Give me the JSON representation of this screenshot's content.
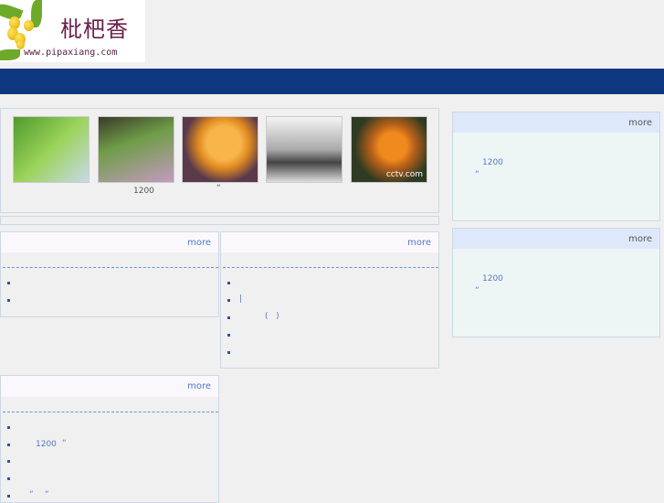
{
  "logo": {
    "title": "枇杷香",
    "url": "www.pipaxiang.com"
  },
  "photo_strip": {
    "captions": [
      "1200",
      "“"
    ],
    "watermark": "cctv.com"
  },
  "side_panels": [
    {
      "more": "more",
      "item": "1200",
      "quote": "“"
    },
    {
      "more": "more",
      "item": "1200",
      "quote": "“"
    }
  ],
  "news_panels": [
    {
      "more": "more"
    },
    {
      "more": "more",
      "item2": "|",
      "item3": "(   )"
    },
    {
      "more": "more",
      "item2": "1200",
      "item2_quote": "“",
      "item5_a": "“",
      "item5_b": "“"
    }
  ],
  "colors": {
    "nav": "#0d3880",
    "link": "#5577cc"
  }
}
